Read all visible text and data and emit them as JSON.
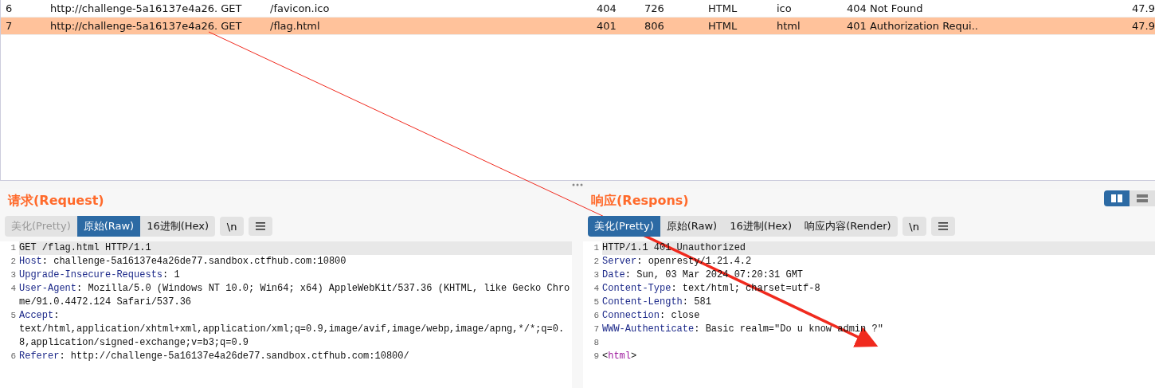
{
  "table": {
    "rows": [
      {
        "selected": false,
        "cells": [
          "6",
          "http://challenge-5a16137e4a26. GET",
          "/favicon.ico",
          "404",
          "726",
          "HTML",
          "ico",
          "404 Not Found",
          "47.9"
        ]
      },
      {
        "selected": true,
        "cells": [
          "7",
          "http://challenge-5a16137e4a26. GET",
          "/flag.html",
          "401",
          "806",
          "HTML",
          "html",
          "401 Authorization Requi..",
          "47.9"
        ]
      }
    ]
  },
  "layout_toggle": [
    {
      "kind": "split",
      "selected": true
    },
    {
      "kind": "stacked",
      "selected": false
    }
  ],
  "request": {
    "title": "请求(Request)",
    "tabs": [
      {
        "label": "美化(Pretty)",
        "selected": false,
        "disabled": true
      },
      {
        "label": "原始(Raw)",
        "selected": true,
        "disabled": false
      },
      {
        "label": "16进制(Hex)",
        "selected": false,
        "disabled": false
      }
    ],
    "newline_button": "\\n",
    "lines": [
      {
        "number": "1",
        "value": "GET /flag.html HTTP/1.1"
      },
      {
        "number": "2",
        "name": "Host",
        "separator": ":",
        "value": "challenge-5a16137e4a26de77.sandbox.ctfhub.com:10800",
        "value_on_new_line": false
      },
      {
        "number": "3",
        "name": "Upgrade-Insecure-Requests",
        "separator": ":",
        "value": "1",
        "value_on_new_line": false
      },
      {
        "number": "4",
        "name": "User-Agent",
        "separator": ":",
        "value": "Mozilla/5.0 (Windows NT 10.0; Win64; x64) AppleWebKit/537.36 (KHTML, like Gecko Chrome/91.0.4472.124 Safari/537.36",
        "value_on_new_line": false
      },
      {
        "number": "5",
        "name": "Accept",
        "separator": ":",
        "value": "text/html,application/xhtml+xml,application/xml;q=0.9,image/avif,image/webp,image/apng,*/*;q=0.8,application/signed-exchange;v=b3;q=0.9",
        "value_on_new_line": true
      },
      {
        "number": "6",
        "name": "Referer",
        "separator": ":",
        "value": "http://challenge-5a16137e4a26de77.sandbox.ctfhub.com:10800/",
        "value_on_new_line": false
      }
    ]
  },
  "response": {
    "title": "响应(Respons)",
    "tabs": [
      {
        "label": "美化(Pretty)",
        "selected": true,
        "disabled": false
      },
      {
        "label": "原始(Raw)",
        "selected": false,
        "disabled": false
      },
      {
        "label": "16进制(Hex)",
        "selected": false,
        "disabled": false
      },
      {
        "label": "响应内容(Render)",
        "selected": false,
        "disabled": false
      }
    ],
    "newline_button": "\\n",
    "lines": [
      {
        "number": "1",
        "value": "HTTP/1.1 401 Unauthorized"
      },
      {
        "number": "2",
        "name": "Server",
        "separator": ":",
        "value": "openresty/1.21.4.2",
        "value_on_new_line": false
      },
      {
        "number": "3",
        "name": "Date",
        "separator": ":",
        "value": "Sun, 03 Mar 2024 07:20:31 GMT",
        "value_on_new_line": false
      },
      {
        "number": "4",
        "name": "Content-Type",
        "separator": ":",
        "value": "text/html; charset=utf-8",
        "value_on_new_line": false
      },
      {
        "number": "5",
        "name": "Content-Length",
        "separator": ":",
        "value": "581",
        "value_on_new_line": false
      },
      {
        "number": "6",
        "name": "Connection",
        "separator": ":",
        "value": "close",
        "value_on_new_line": false
      },
      {
        "number": "7",
        "name": "WWW-Authenticate",
        "separator": ":",
        "value": "Basic realm=\"Do u know admin ?\"",
        "value_on_new_line": false
      },
      {
        "number": "8"
      },
      {
        "number": "9",
        "open": "<",
        "tag": "html",
        "close": ">"
      }
    ]
  }
}
